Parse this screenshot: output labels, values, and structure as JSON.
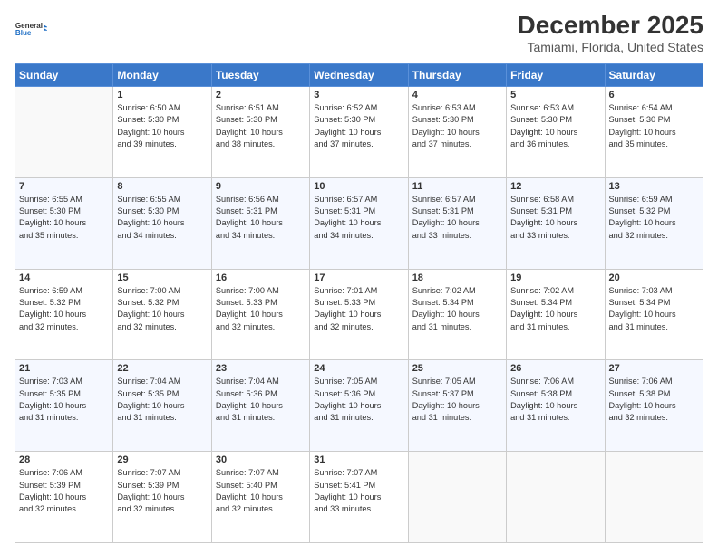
{
  "header": {
    "logo_line1": "General",
    "logo_line2": "Blue",
    "main_title": "December 2025",
    "subtitle": "Tamiami, Florida, United States"
  },
  "days_of_week": [
    "Sunday",
    "Monday",
    "Tuesday",
    "Wednesday",
    "Thursday",
    "Friday",
    "Saturday"
  ],
  "weeks": [
    [
      {
        "day": "",
        "info": ""
      },
      {
        "day": "1",
        "info": "Sunrise: 6:50 AM\nSunset: 5:30 PM\nDaylight: 10 hours\nand 39 minutes."
      },
      {
        "day": "2",
        "info": "Sunrise: 6:51 AM\nSunset: 5:30 PM\nDaylight: 10 hours\nand 38 minutes."
      },
      {
        "day": "3",
        "info": "Sunrise: 6:52 AM\nSunset: 5:30 PM\nDaylight: 10 hours\nand 37 minutes."
      },
      {
        "day": "4",
        "info": "Sunrise: 6:53 AM\nSunset: 5:30 PM\nDaylight: 10 hours\nand 37 minutes."
      },
      {
        "day": "5",
        "info": "Sunrise: 6:53 AM\nSunset: 5:30 PM\nDaylight: 10 hours\nand 36 minutes."
      },
      {
        "day": "6",
        "info": "Sunrise: 6:54 AM\nSunset: 5:30 PM\nDaylight: 10 hours\nand 35 minutes."
      }
    ],
    [
      {
        "day": "7",
        "info": "Sunrise: 6:55 AM\nSunset: 5:30 PM\nDaylight: 10 hours\nand 35 minutes."
      },
      {
        "day": "8",
        "info": "Sunrise: 6:55 AM\nSunset: 5:30 PM\nDaylight: 10 hours\nand 34 minutes."
      },
      {
        "day": "9",
        "info": "Sunrise: 6:56 AM\nSunset: 5:31 PM\nDaylight: 10 hours\nand 34 minutes."
      },
      {
        "day": "10",
        "info": "Sunrise: 6:57 AM\nSunset: 5:31 PM\nDaylight: 10 hours\nand 34 minutes."
      },
      {
        "day": "11",
        "info": "Sunrise: 6:57 AM\nSunset: 5:31 PM\nDaylight: 10 hours\nand 33 minutes."
      },
      {
        "day": "12",
        "info": "Sunrise: 6:58 AM\nSunset: 5:31 PM\nDaylight: 10 hours\nand 33 minutes."
      },
      {
        "day": "13",
        "info": "Sunrise: 6:59 AM\nSunset: 5:32 PM\nDaylight: 10 hours\nand 32 minutes."
      }
    ],
    [
      {
        "day": "14",
        "info": "Sunrise: 6:59 AM\nSunset: 5:32 PM\nDaylight: 10 hours\nand 32 minutes."
      },
      {
        "day": "15",
        "info": "Sunrise: 7:00 AM\nSunset: 5:32 PM\nDaylight: 10 hours\nand 32 minutes."
      },
      {
        "day": "16",
        "info": "Sunrise: 7:00 AM\nSunset: 5:33 PM\nDaylight: 10 hours\nand 32 minutes."
      },
      {
        "day": "17",
        "info": "Sunrise: 7:01 AM\nSunset: 5:33 PM\nDaylight: 10 hours\nand 32 minutes."
      },
      {
        "day": "18",
        "info": "Sunrise: 7:02 AM\nSunset: 5:34 PM\nDaylight: 10 hours\nand 31 minutes."
      },
      {
        "day": "19",
        "info": "Sunrise: 7:02 AM\nSunset: 5:34 PM\nDaylight: 10 hours\nand 31 minutes."
      },
      {
        "day": "20",
        "info": "Sunrise: 7:03 AM\nSunset: 5:34 PM\nDaylight: 10 hours\nand 31 minutes."
      }
    ],
    [
      {
        "day": "21",
        "info": "Sunrise: 7:03 AM\nSunset: 5:35 PM\nDaylight: 10 hours\nand 31 minutes."
      },
      {
        "day": "22",
        "info": "Sunrise: 7:04 AM\nSunset: 5:35 PM\nDaylight: 10 hours\nand 31 minutes."
      },
      {
        "day": "23",
        "info": "Sunrise: 7:04 AM\nSunset: 5:36 PM\nDaylight: 10 hours\nand 31 minutes."
      },
      {
        "day": "24",
        "info": "Sunrise: 7:05 AM\nSunset: 5:36 PM\nDaylight: 10 hours\nand 31 minutes."
      },
      {
        "day": "25",
        "info": "Sunrise: 7:05 AM\nSunset: 5:37 PM\nDaylight: 10 hours\nand 31 minutes."
      },
      {
        "day": "26",
        "info": "Sunrise: 7:06 AM\nSunset: 5:38 PM\nDaylight: 10 hours\nand 31 minutes."
      },
      {
        "day": "27",
        "info": "Sunrise: 7:06 AM\nSunset: 5:38 PM\nDaylight: 10 hours\nand 32 minutes."
      }
    ],
    [
      {
        "day": "28",
        "info": "Sunrise: 7:06 AM\nSunset: 5:39 PM\nDaylight: 10 hours\nand 32 minutes."
      },
      {
        "day": "29",
        "info": "Sunrise: 7:07 AM\nSunset: 5:39 PM\nDaylight: 10 hours\nand 32 minutes."
      },
      {
        "day": "30",
        "info": "Sunrise: 7:07 AM\nSunset: 5:40 PM\nDaylight: 10 hours\nand 32 minutes."
      },
      {
        "day": "31",
        "info": "Sunrise: 7:07 AM\nSunset: 5:41 PM\nDaylight: 10 hours\nand 33 minutes."
      },
      {
        "day": "",
        "info": ""
      },
      {
        "day": "",
        "info": ""
      },
      {
        "day": "",
        "info": ""
      }
    ]
  ]
}
